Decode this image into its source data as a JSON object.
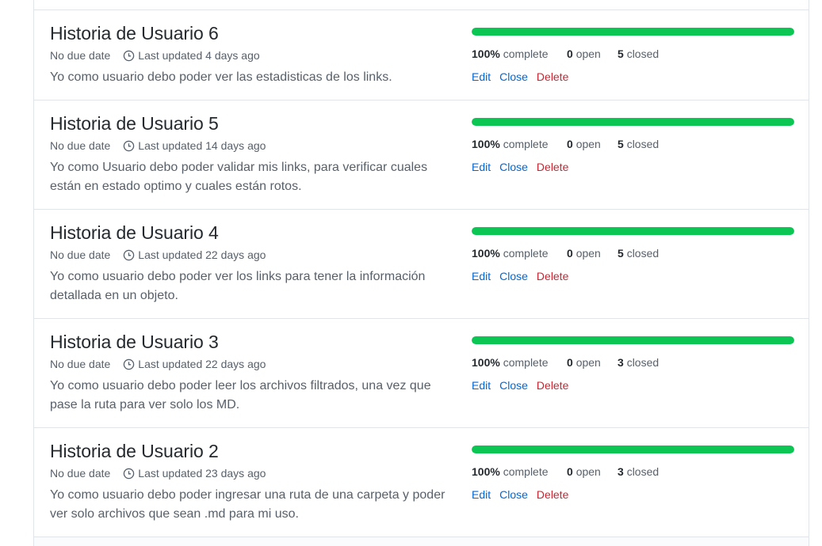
{
  "milestones": [
    {
      "title": "Historia de Usuario 6",
      "due": "No due date",
      "updated": "Last updated 4 days ago",
      "description": "Yo como usuario debo poder ver las estadisticas de los links.",
      "progress_percent": 100,
      "percent_value": "100%",
      "percent_label": "complete",
      "open_count": "0",
      "open_label": "open",
      "closed_count": "5",
      "closed_label": "closed",
      "actions": {
        "edit": "Edit",
        "close": "Close",
        "delete": "Delete"
      }
    },
    {
      "title": "Historia de Usuario 5",
      "due": "No due date",
      "updated": "Last updated 14 days ago",
      "description": "Yo como Usuario debo poder validar mis links, para verificar cuales están en estado optimo y cuales están rotos.",
      "progress_percent": 100,
      "percent_value": "100%",
      "percent_label": "complete",
      "open_count": "0",
      "open_label": "open",
      "closed_count": "5",
      "closed_label": "closed",
      "actions": {
        "edit": "Edit",
        "close": "Close",
        "delete": "Delete"
      }
    },
    {
      "title": "Historia de Usuario 4",
      "due": "No due date",
      "updated": "Last updated 22 days ago",
      "description": "Yo como usuario debo poder ver los links para tener la información detallada en un objeto.",
      "progress_percent": 100,
      "percent_value": "100%",
      "percent_label": "complete",
      "open_count": "0",
      "open_label": "open",
      "closed_count": "5",
      "closed_label": "closed",
      "actions": {
        "edit": "Edit",
        "close": "Close",
        "delete": "Delete"
      }
    },
    {
      "title": "Historia de Usuario 3",
      "due": "No due date",
      "updated": "Last updated 22 days ago",
      "description": "Yo como usuario debo poder leer los archivos filtrados, una vez que pase la ruta para ver solo los MD.",
      "progress_percent": 100,
      "percent_value": "100%",
      "percent_label": "complete",
      "open_count": "0",
      "open_label": "open",
      "closed_count": "3",
      "closed_label": "closed",
      "actions": {
        "edit": "Edit",
        "close": "Close",
        "delete": "Delete"
      }
    },
    {
      "title": "Historia de Usuario 2",
      "due": "No due date",
      "updated": "Last updated 23 days ago",
      "description": "Yo como usuario debo poder ingresar una ruta de una carpeta y poder ver solo archivos que sean .md para mi uso.",
      "progress_percent": 100,
      "percent_value": "100%",
      "percent_label": "complete",
      "open_count": "0",
      "open_label": "open",
      "closed_count": "3",
      "closed_label": "closed",
      "actions": {
        "edit": "Edit",
        "close": "Close",
        "delete": "Delete"
      }
    }
  ],
  "colors": {
    "progress": "#0cc654",
    "link": "#0366d6",
    "danger": "#cb2431",
    "muted": "#586069"
  },
  "icons": {
    "updated": "clock-icon"
  }
}
